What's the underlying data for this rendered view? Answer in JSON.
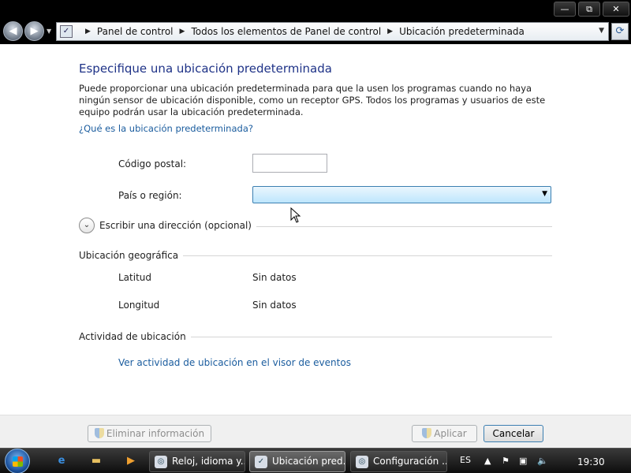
{
  "window": {
    "controls": {
      "minimize": "—",
      "maximize": "⧉",
      "close": "✕"
    }
  },
  "nav": {
    "back_icon": "◀",
    "forward_icon": "▶",
    "breadcrumbs": [
      "Panel de control",
      "Todos los elementos de Panel de control",
      "Ubicación predeterminada"
    ],
    "refresh_icon": "⟳"
  },
  "page": {
    "title": "Especifique una ubicación predeterminada",
    "description": "Puede proporcionar una ubicación predeterminada para que la usen los programas cuando no haya ningún sensor de ubicación disponible, como un receptor GPS. Todos los programas y usuarios de este equipo podrán usar la ubicación predeterminada.",
    "help_link": "¿Qué es la ubicación predeterminada?",
    "postal_code_label": "Código postal:",
    "postal_code_value": "",
    "country_label": "País o región:",
    "country_value": "",
    "address_expander": "Escribir una dirección (opcional)",
    "geo_section": "Ubicación geográfica",
    "latitude_label": "Latitud",
    "latitude_value": "Sin datos",
    "longitude_label": "Longitud",
    "longitude_value": "Sin datos",
    "activity_section": "Actividad de ubicación",
    "activity_link": "Ver actividad de ubicación en el visor de eventos"
  },
  "buttons": {
    "remove": "Eliminar información",
    "apply": "Aplicar",
    "cancel": "Cancelar"
  },
  "taskbar": {
    "tasks": [
      {
        "label": "Reloj, idioma y..."
      },
      {
        "label": "Ubicación pred..."
      },
      {
        "label": "Configuración ..."
      }
    ],
    "language": "ES",
    "clock": "19:30"
  }
}
